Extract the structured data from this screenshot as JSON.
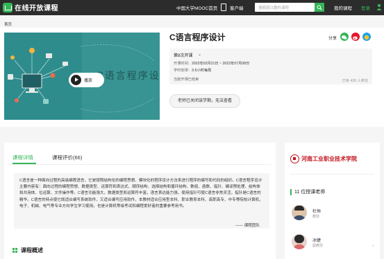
{
  "header": {
    "logo_text": "在线开放课程",
    "nav_mooc": "中国大学MOOC首页",
    "nav_app": "客户端",
    "search_placeholder": "搜索感兴趣的课程",
    "my_courses": "我的课程",
    "login": "登录"
  },
  "breadcrumb": "首页",
  "course": {
    "cover_title": "C语言程序设计",
    "play_label": "播放",
    "title": "C语言程序设计",
    "share_label": "分享",
    "term_label": "第8次开课",
    "time_label": "开课时间：",
    "time_value": "2022年02月21日 ~ 2022年07月08日",
    "hours_label": "学时安排：",
    "hours_value": "3-5小时每周",
    "status": "当前开课已结束",
    "enrolled": "已有 438 人参加",
    "closed_button": "老师已关闭该学期，无法查看"
  },
  "tabs": [
    {
      "label": "课程详情",
      "active": true
    },
    {
      "label": "课程评价(66)",
      "active": false
    }
  ],
  "intro": {
    "text": "C语言是一种面向过程的高级编程语言，它是按照结构化的编程思想、模块化的程序设计方法来进行程序的编写和代码的组织。C语言程序设计主要内容有：面向过程的编程思想、数据类型、运算符和表达式、顺序结构、选择结构和循环结构、数组、函数、指针、编译预处理、结构体和共用体、位运算、文件操作等。C语言功能强大，数据类型和运算符丰富，语言表达能力强，使用指针可使C语言非常灵活，指针是C语言的精华。C语言的特点使它既适合编写系统软件，又适合编写应用软件，本教材适合应用型本科、职业教育本科、高职高专、中专等院校计算机、电子、机械、电气等专业方向学生学习使用，也是计算机等级考试和编程爱好者的重要参考用书。",
    "signature": "—— 课程团队"
  },
  "section_title": "课程概述",
  "sidebar": {
    "school_name": "河南工业职业技术学院",
    "teacher_count": "11 位授课老师",
    "teachers": [
      {
        "name": "杜恒",
        "title": "教授"
      },
      {
        "name": "冰婕",
        "title": "副教授"
      }
    ]
  },
  "colors": {
    "accent": "#35b558",
    "nav_bg": "#2c2c2c",
    "cover_bg": "#2f8c8d",
    "school_red": "#c0121e"
  }
}
